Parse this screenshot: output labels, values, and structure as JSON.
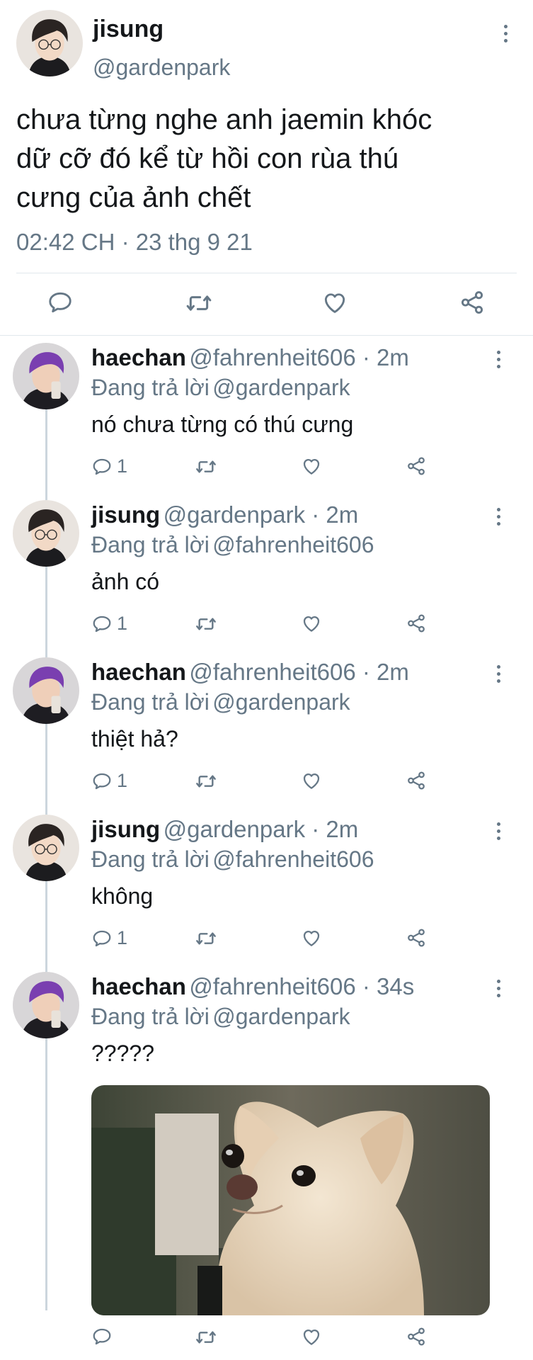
{
  "main_tweet": {
    "name": "jisung",
    "handle": "@gardenpark",
    "text_lines": [
      "chưa từng nghe anh jaemin khóc",
      "dữ cỡ đó kể từ hồi con rùa thú",
      "cưng của ảnh chết"
    ],
    "timestamp": "02:42 CH · 23 thg 9 21"
  },
  "replies": [
    {
      "name": "haechan",
      "handle": "@fahrenheit606 · 2m",
      "reply_prefix": "Đang trả lời",
      "reply_to": "@gardenpark",
      "text": "nó chưa từng có thú cưng",
      "reply_count": "1",
      "avatar": "haechan"
    },
    {
      "name": "jisung",
      "handle": "@gardenpark · 2m",
      "reply_prefix": "Đang trả lời",
      "reply_to": "@fahrenheit606",
      "text": "ảnh có",
      "reply_count": "1",
      "avatar": "jisung"
    },
    {
      "name": "haechan",
      "handle": "@fahrenheit606 · 2m",
      "reply_prefix": "Đang trả lời",
      "reply_to": "@gardenpark",
      "text": "thiệt hả?",
      "reply_count": "1",
      "avatar": "haechan"
    },
    {
      "name": "jisung",
      "handle": "@gardenpark · 2m",
      "reply_prefix": "Đang trả lời",
      "reply_to": "@fahrenheit606",
      "text": "không",
      "reply_count": "1",
      "avatar": "jisung"
    },
    {
      "name": "haechan",
      "handle": "@fahrenheit606 · 34s",
      "reply_prefix": "Đang trả lời",
      "reply_to": "@gardenpark",
      "text": "?????",
      "reply_count": "",
      "avatar": "haechan"
    }
  ],
  "colors": {
    "accent": "#1da1f2",
    "secondary_text": "#657786",
    "divider": "#e1e8ed"
  },
  "icons": [
    "more-vertical-icon",
    "reply-icon",
    "retweet-icon",
    "like-icon",
    "share-icon"
  ]
}
